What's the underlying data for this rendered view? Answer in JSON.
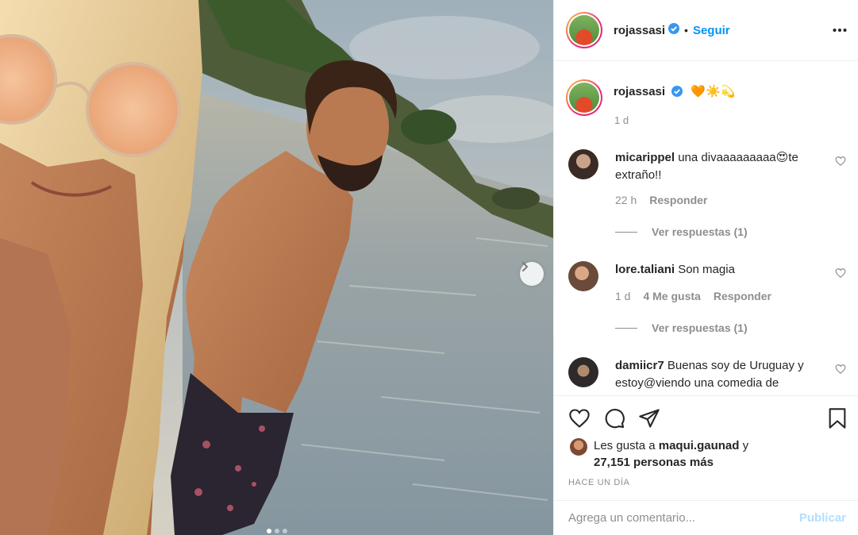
{
  "post": {
    "username": "rojassasi",
    "follow_label": "Seguir",
    "separator": "•",
    "caption_emoji": "🧡☀️💫",
    "caption_time": "1 d",
    "photo_alt": "",
    "carousel": {
      "dots": 3,
      "active": 0
    }
  },
  "comments": [
    {
      "user": "micarippel",
      "text": "una divaaaaaaaaa😍te extraño!!",
      "time": "22 h",
      "likes": "",
      "reply_label": "Responder",
      "view_replies": "Ver respuestas (1)"
    },
    {
      "user": "lore.taliani",
      "text": "Son magia",
      "time": "1 d",
      "likes": "4 Me gusta",
      "reply_label": "Responder",
      "view_replies": "Ver respuestas (1)"
    },
    {
      "user": "damiicr7",
      "text": "Buenas soy de Uruguay y estoy@viendo una comedia de",
      "time": "",
      "likes": "",
      "reply_label": "",
      "view_replies": ""
    }
  ],
  "footer": {
    "likes_prefix": "Les gusta a",
    "likes_user": "maqui.gaunad",
    "likes_and": "y",
    "likes_count": "27,151 personas más",
    "posted_ago": "HACE UN DÍA",
    "comment_placeholder": "Agrega un comentario...",
    "publish_label": "Publicar"
  },
  "colors": {
    "accent": "#0095f6",
    "muted": "#8e8e8e",
    "publish_disabled": "#b2dffc"
  },
  "icons": [
    "verified-badge-icon",
    "more-options-icon",
    "heart-icon",
    "comment-icon",
    "share-icon",
    "bookmark-icon",
    "chevron-right-icon"
  ]
}
